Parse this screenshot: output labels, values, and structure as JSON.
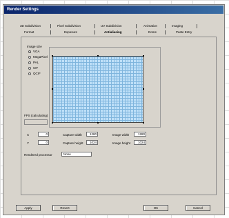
{
  "window": {
    "title": "Render Settings"
  },
  "tabs_row1": [
    {
      "label": "3D Subdivision"
    },
    {
      "label": "Pixel Subdivision"
    },
    {
      "label": "UV Subdivision"
    },
    {
      "label": "Animation"
    },
    {
      "label": "Imaging"
    }
  ],
  "tabs_row2": [
    {
      "label": "Format"
    },
    {
      "label": "Exposure"
    },
    {
      "label": "Antialiasing",
      "active": true
    },
    {
      "label": "Dome"
    },
    {
      "label": "Paste Entry"
    }
  ],
  "image_size": {
    "label": "Image size",
    "options": [
      "VGA",
      "MegaPixel",
      "PAL",
      "CIF",
      "QCIF"
    ],
    "selected": "VGA"
  },
  "fps_section": {
    "label": "FPS (calculating)"
  },
  "fields": {
    "x_label": "X",
    "x_value": "0",
    "y_label": "Y",
    "y_value": "0",
    "capture_width_label": "Capture width",
    "capture_width_value": "1280",
    "capture_height_label": "Capture height",
    "capture_height_value": "1024",
    "image_width_label": "Image width",
    "image_width_value": "1280",
    "image_height_label": "Image height",
    "image_height_value": "1024",
    "rendered_processor_label": "Rendered processor",
    "rendered_processor_value": "None"
  },
  "buttons": {
    "apply": "Apply",
    "revert": "Revert",
    "ok": "OK",
    "cancel": "Cancel"
  }
}
